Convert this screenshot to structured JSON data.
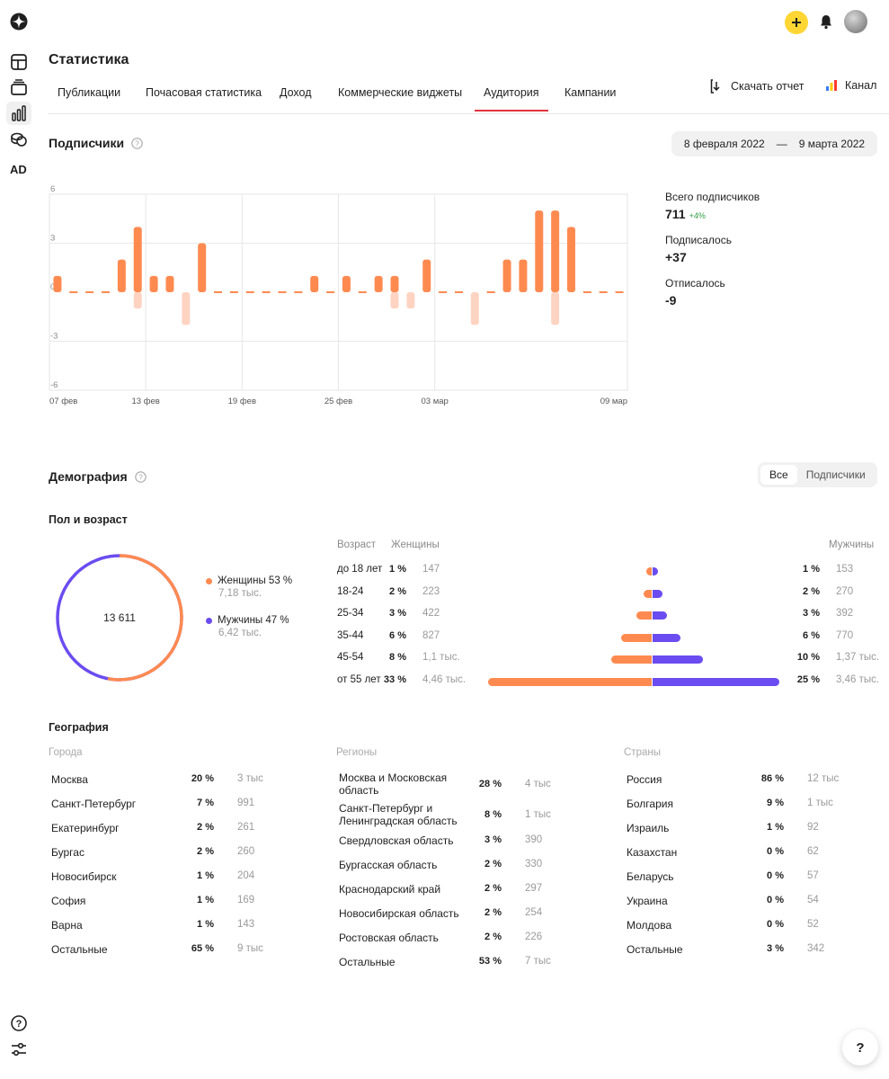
{
  "header": {
    "title": "Статистика",
    "tabs": [
      "Публикации",
      "Почасовая статистика",
      "Доход",
      "Коммерческие виджеты",
      "Аудитория",
      "Кампании"
    ],
    "active_tab": "Аудитория",
    "download_label": "Скачать отчет",
    "channel_label": "Канал"
  },
  "sidebar": {
    "ad_label": "AD"
  },
  "subscribers": {
    "title": "Подписчики",
    "date_from": "8 февраля 2022",
    "date_sep": "—",
    "date_to": "9 марта 2022",
    "total_label": "Всего подписчиков",
    "total_value": "711",
    "total_delta": "+4%",
    "subscribed_label": "Подписалось",
    "subscribed_value": "+37",
    "unsubscribed_label": "Отписалось",
    "unsubscribed_value": "-9"
  },
  "chart_data": {
    "type": "bar",
    "ylim": [
      -6,
      6
    ],
    "y_ticks": [
      "6",
      "3",
      "0",
      "-3",
      "-6"
    ],
    "x_ticks": [
      "07 фев",
      "13 фев",
      "19 фев",
      "25 фев",
      "03 мар",
      "09 мар"
    ],
    "colors": {
      "positive": "#ff8a50",
      "negative": "#ffd3c2"
    },
    "series": [
      {
        "values": [
          1,
          0,
          0,
          0,
          2,
          4,
          1,
          1,
          0,
          3,
          0,
          0,
          0,
          0,
          0,
          0,
          1,
          0,
          1,
          0,
          1,
          1,
          0,
          2,
          0,
          0,
          0,
          0,
          2,
          2,
          5,
          5,
          4,
          0,
          0,
          0
        ]
      },
      {
        "values": [
          0,
          0,
          0,
          0,
          0,
          -1,
          0,
          0,
          -2,
          0,
          0,
          0,
          0,
          0,
          0,
          0,
          0,
          0,
          0,
          0,
          0,
          -1,
          -1,
          0,
          0,
          0,
          -2,
          0,
          0,
          0,
          0,
          -2,
          0,
          0,
          0,
          0
        ]
      }
    ]
  },
  "demography": {
    "title": "Демография",
    "toggle_all": "Все",
    "toggle_subscribers": "Подписчики",
    "gender_age_title": "Пол и возраст",
    "donut_total": "13 611",
    "donut_fractions": {
      "women": 0.53,
      "men": 0.47
    },
    "colors": {
      "women": "#ff8a50",
      "men": "#6b4cf0"
    },
    "legend_women": "Женщины 53 %",
    "legend_women_sub": "7,18 тыс.",
    "legend_men": "Мужчины 47 %",
    "legend_men_sub": "6,42 тыс.",
    "col_age": "Возраст",
    "col_women": "Женщины",
    "col_men": "Мужчины",
    "age_rows": [
      {
        "age": "до 18 лет",
        "w_pct": "1 %",
        "w_cnt": "147",
        "m_pct": "1 %",
        "m_cnt": "153",
        "w_val": 147,
        "m_val": 153
      },
      {
        "age": "18-24",
        "w_pct": "2 %",
        "w_cnt": "223",
        "m_pct": "2 %",
        "m_cnt": "270",
        "w_val": 223,
        "m_val": 270
      },
      {
        "age": "25-34",
        "w_pct": "3 %",
        "w_cnt": "422",
        "m_pct": "3 %",
        "m_cnt": "392",
        "w_val": 422,
        "m_val": 392
      },
      {
        "age": "35-44",
        "w_pct": "6 %",
        "w_cnt": "827",
        "m_pct": "6 %",
        "m_cnt": "770",
        "w_val": 827,
        "m_val": 770
      },
      {
        "age": "45-54",
        "w_pct": "8 %",
        "w_cnt": "1,1 тыс.",
        "m_pct": "10 %",
        "m_cnt": "1,37 тыс.",
        "w_val": 1100,
        "m_val": 1370
      },
      {
        "age": "от 55 лет",
        "w_pct": "33 %",
        "w_cnt": "4,46 тыс.",
        "m_pct": "25 %",
        "m_cnt": "3,46 тыс.",
        "w_val": 4460,
        "m_val": 3460
      }
    ]
  },
  "geography": {
    "title": "География",
    "cities_title": "Города",
    "regions_title": "Регионы",
    "countries_title": "Страны",
    "cities": [
      {
        "name": "Москва",
        "pct": "20 %",
        "cnt": "3 тыс"
      },
      {
        "name": "Санкт-Петербург",
        "pct": "7 %",
        "cnt": "991"
      },
      {
        "name": "Екатеринбург",
        "pct": "2 %",
        "cnt": "261"
      },
      {
        "name": "Бургас",
        "pct": "2 %",
        "cnt": "260"
      },
      {
        "name": "Новосибирск",
        "pct": "1 %",
        "cnt": "204"
      },
      {
        "name": "София",
        "pct": "1 %",
        "cnt": "169"
      },
      {
        "name": "Варна",
        "pct": "1 %",
        "cnt": "143"
      },
      {
        "name": "Остальные",
        "pct": "65 %",
        "cnt": "9 тыс"
      }
    ],
    "regions": [
      {
        "name": "Москва и Московская область",
        "pct": "28 %",
        "cnt": "4 тыс"
      },
      {
        "name": "Санкт-Петербург и Ленинградская область",
        "pct": "8 %",
        "cnt": "1 тыс"
      },
      {
        "name": "Свердловская область",
        "pct": "3 %",
        "cnt": "390"
      },
      {
        "name": "Бургасская область",
        "pct": "2 %",
        "cnt": "330"
      },
      {
        "name": "Краснодарский край",
        "pct": "2 %",
        "cnt": "297"
      },
      {
        "name": "Новосибирская область",
        "pct": "2 %",
        "cnt": "254"
      },
      {
        "name": "Ростовская область",
        "pct": "2 %",
        "cnt": "226"
      },
      {
        "name": "Остальные",
        "pct": "53 %",
        "cnt": "7 тыс"
      }
    ],
    "countries": [
      {
        "name": "Россия",
        "pct": "86 %",
        "cnt": "12 тыс"
      },
      {
        "name": "Болгария",
        "pct": "9 %",
        "cnt": "1 тыс"
      },
      {
        "name": "Израиль",
        "pct": "1 %",
        "cnt": "92"
      },
      {
        "name": "Казахстан",
        "pct": "0 %",
        "cnt": "62"
      },
      {
        "name": "Беларусь",
        "pct": "0 %",
        "cnt": "57"
      },
      {
        "name": "Украина",
        "pct": "0 %",
        "cnt": "54"
      },
      {
        "name": "Молдова",
        "pct": "0 %",
        "cnt": "52"
      },
      {
        "name": "Остальные",
        "pct": "3 %",
        "cnt": "342"
      }
    ]
  },
  "help_button": "?"
}
